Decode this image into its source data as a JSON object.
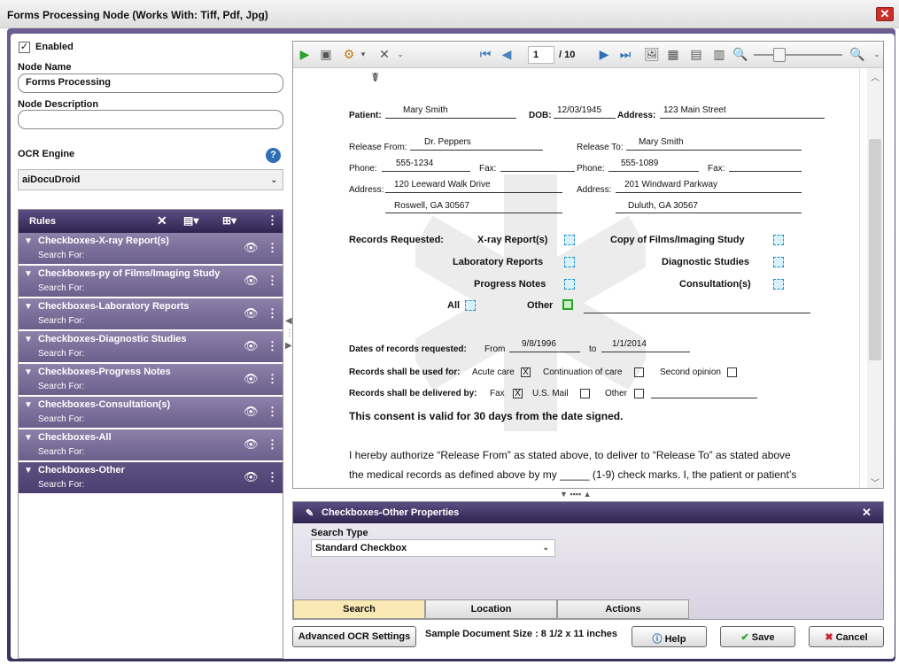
{
  "window": {
    "title": "Forms Processing Node    (Works With: Tiff, Pdf, Jpg)",
    "close_glyph": "✕"
  },
  "left": {
    "enabled_label": "Enabled",
    "node_name_label": "Node Name",
    "node_name_value": "Forms Processing",
    "node_desc_label": "Node Description",
    "node_desc_value": "",
    "ocr_label": "OCR Engine",
    "ocr_value": "aiDocuDroid"
  },
  "rules": {
    "title": "Rules",
    "items": [
      {
        "title": "Checkboxes-X-ray Report(s)",
        "sub": "Search For:"
      },
      {
        "title": "Checkboxes-py of Films/Imaging Study",
        "sub": "Search For:"
      },
      {
        "title": "Checkboxes-Laboratory Reports",
        "sub": "Search For:"
      },
      {
        "title": "Checkboxes-Diagnostic Studies",
        "sub": "Search For:"
      },
      {
        "title": "Checkboxes-Progress Notes",
        "sub": "Search For:"
      },
      {
        "title": "Checkboxes-Consultation(s)",
        "sub": "Search For:"
      },
      {
        "title": "Checkboxes-All",
        "sub": "Search For:"
      },
      {
        "title": "Checkboxes-Other",
        "sub": "Search For:"
      }
    ]
  },
  "viewer": {
    "page_current": "1",
    "page_total": "/ 10"
  },
  "document": {
    "patient_label": "Patient:",
    "patient": "Mary Smith",
    "dob_label": "DOB:",
    "dob": "12/03/1945",
    "address_label": "Address:",
    "address": "123 Main Street",
    "release_from_label": "Release From:",
    "release_from": "Dr. Peppers",
    "release_to_label": "Release To:",
    "release_to": "Mary Smith",
    "phone_label": "Phone:",
    "phone1": "555-1234",
    "fax_label": "Fax:",
    "phone2": "555-1089",
    "addr_label": "Address:",
    "addr1a": "120 Leeward Walk Drive",
    "addr1b": "Roswell, GA 30567",
    "addr2a": "201 Windward Parkway",
    "addr2b": "Duluth, GA 30567",
    "records_requested": "Records Requested:",
    "xray": "X-ray Report(s)",
    "copy_films": "Copy of Films/Imaging Study",
    "lab": "Laboratory Reports",
    "diag": "Diagnostic Studies",
    "progress": "Progress Notes",
    "consult": "Consultation(s)",
    "all": "All",
    "other": "Other",
    "dates_label": "Dates of records requested:",
    "from_label": "From",
    "from": "9/8/1996",
    "to_label": "to",
    "to": "1/1/2014",
    "used_for": "Records shall be used for:",
    "acute": "Acute care",
    "continuation": "Continuation of care",
    "second": "Second opinion",
    "delivered_by": "Records shall be delivered by:",
    "fax": "Fax",
    "usmail": "U.S. Mail",
    "other2": "Other",
    "consent": "This consent is valid for 30 days from the date signed.",
    "para1": "I hereby authorize  “Release From” as stated above,  to deliver to  “Release To” as stated above",
    "para2": "the medical records as defined above by my _____  (1-9) check marks.  I, the patient or patient’s",
    "check_x": "X"
  },
  "props": {
    "title": "Checkboxes-Other Properties",
    "search_type_label": "Search Type",
    "search_type_value": "Standard Checkbox",
    "tabs": [
      "Search",
      "Location",
      "Actions"
    ]
  },
  "footer": {
    "advanced_ocr": "Advanced OCR Settings",
    "sample_size": "Sample Document Size : 8 1/2 x 11 inches",
    "help": "Help",
    "save": "Save",
    "cancel": "Cancel"
  }
}
